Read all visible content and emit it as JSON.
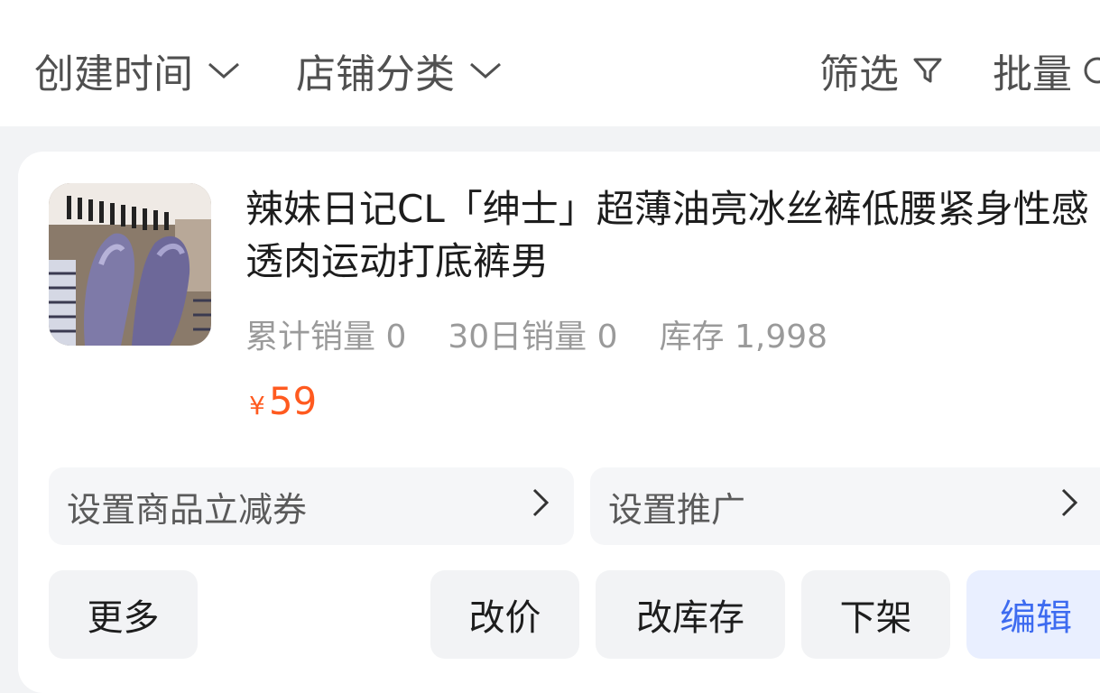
{
  "filters": {
    "created_time": "创建时间",
    "shop_category": "店铺分类",
    "filter": "筛选",
    "batch": "批量"
  },
  "product": {
    "title": "辣妹日记CL「绅士」超薄油亮冰丝裤低腰紧身性感透肉运动打底裤男",
    "stats": {
      "total_sales_label": "累计销量",
      "total_sales_value": "0",
      "sales_30d_label": "30日销量",
      "sales_30d_value": "0",
      "stock_label": "库存",
      "stock_value": "1,998"
    },
    "price": {
      "currency": "¥",
      "value": "59"
    }
  },
  "rows": {
    "coupon": "设置商品立减券",
    "promotion": "设置推广"
  },
  "buttons": {
    "more": "更多",
    "change_price": "改价",
    "change_stock": "改库存",
    "delist": "下架",
    "edit": "编辑"
  },
  "colors": {
    "price": "#ff5a1f",
    "edit_text": "#3d6bf0",
    "edit_bg": "#e9efff",
    "page_bg": "#f2f3f5"
  }
}
